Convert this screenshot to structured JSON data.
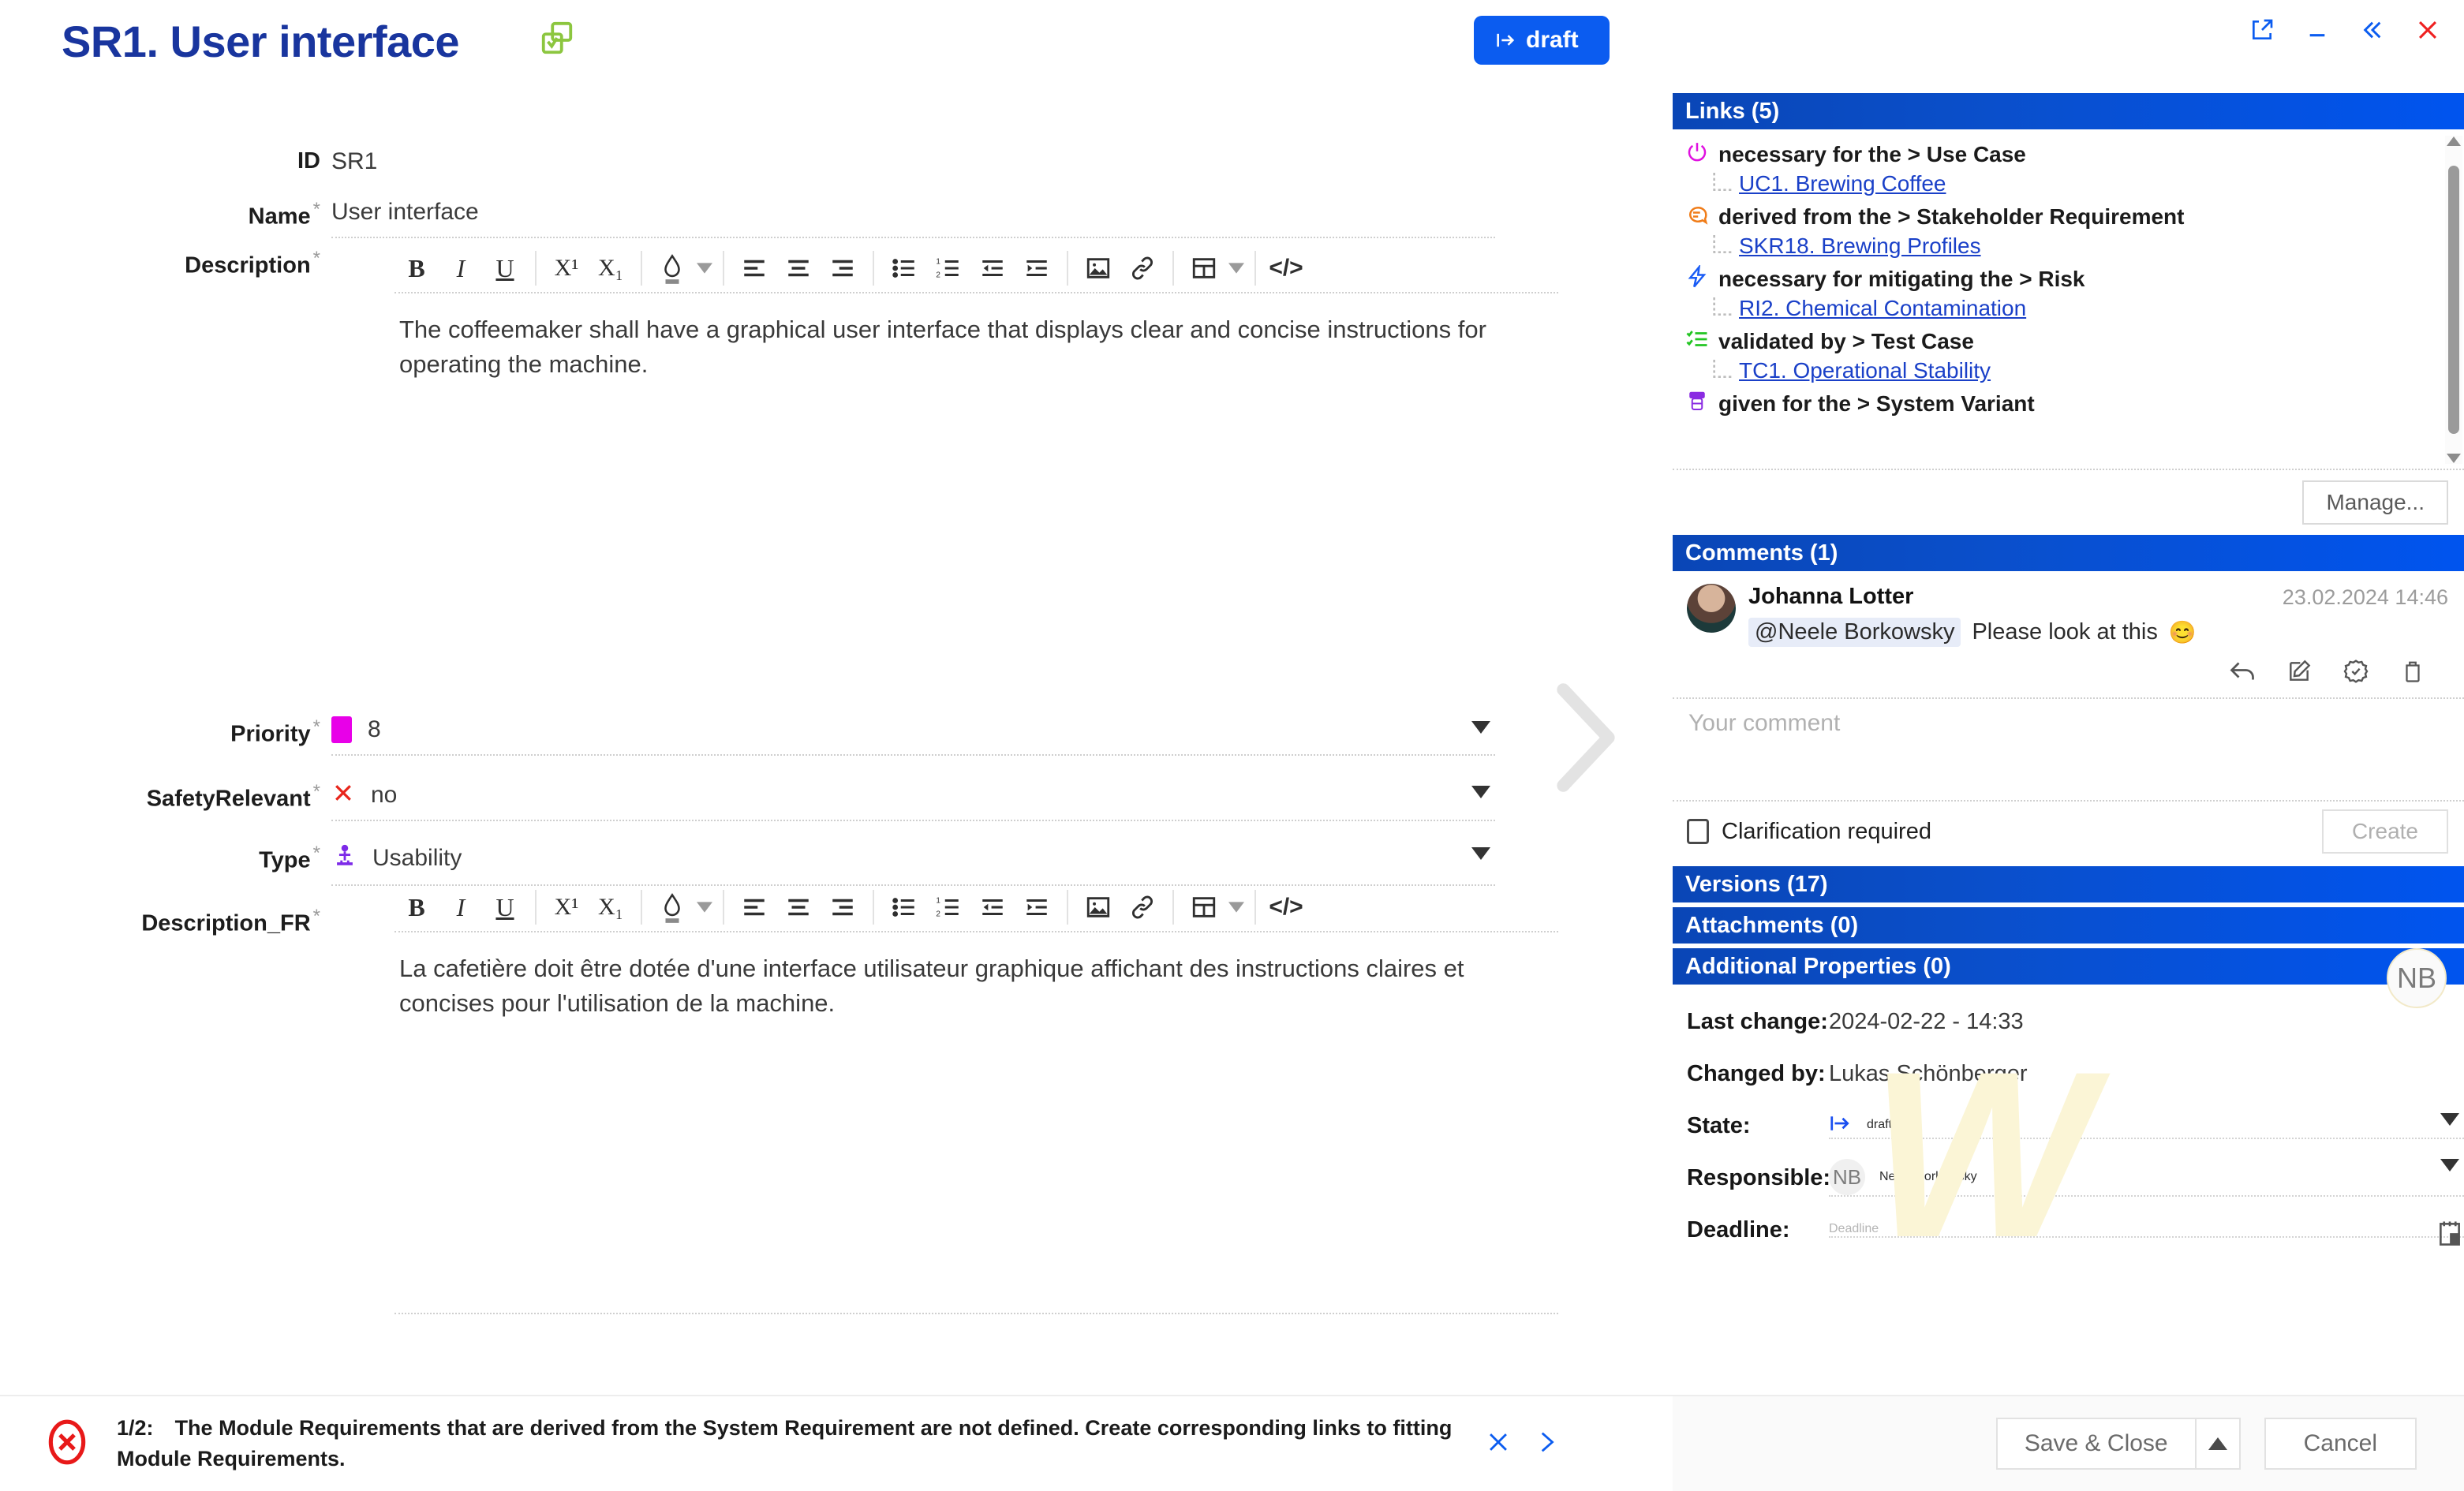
{
  "header": {
    "title": "SR1. User interface",
    "title_icon": "duplicate-document-icon",
    "state_badge": "draft",
    "window_controls": [
      "external-link-icon",
      "minimize-icon",
      "collapse-left-icon",
      "close-icon"
    ]
  },
  "form": {
    "id": {
      "label": "ID",
      "value": "SR1"
    },
    "name": {
      "label": "Name",
      "required": "*",
      "value": "User interface"
    },
    "description": {
      "label": "Description",
      "required": "*",
      "value": "The coffeemaker shall have a graphical user interface that displays clear and concise instructions for operating the machine."
    },
    "priority": {
      "label": "Priority",
      "required": "*",
      "value": "8",
      "color": "#e800e8"
    },
    "safety_relevant": {
      "label": "SafetyRelevant",
      "required": "*",
      "value": "no"
    },
    "type": {
      "label": "Type",
      "required": "*",
      "value": "Usability"
    },
    "description_fr": {
      "label": "Description_FR",
      "required": "*",
      "value": "La cafetière doit être dotée d'une interface utilisateur graphique affichant des instructions claires et concises pour l'utilisation de la machine."
    },
    "toolbar": {
      "bold": "B",
      "italic": "I",
      "underline": "U",
      "superscript": "X¹",
      "subscript": "X₁",
      "text_color": "text-color-icon",
      "color_caret": "chevron-down-icon",
      "align_left": "align-left-icon",
      "align_center": "align-center-icon",
      "align_right": "align-right-icon",
      "bullet_list": "bullet-list-icon",
      "numbered_list": "numbered-list-icon",
      "outdent": "outdent-icon",
      "indent": "indent-icon",
      "image": "image-icon",
      "link": "link-icon",
      "table": "table-icon",
      "table_caret": "chevron-down-icon",
      "source": "</>"
    }
  },
  "sidebar": {
    "links": {
      "title": "Links (5)",
      "groups": [
        {
          "icon": "power-icon",
          "icon_color": "#e011e0",
          "label": "necessary for the > Use Case",
          "children": [
            "UC1. Brewing Coffee"
          ]
        },
        {
          "icon": "speech-bubble-icon",
          "icon_color": "#f07c18",
          "label": "derived from the > Stakeholder Requirement",
          "children": [
            "SKR18. Brewing Profiles"
          ]
        },
        {
          "icon": "lightning-icon",
          "icon_color": "#1a5cf5",
          "label": "necessary for mitigating the > Risk",
          "children": [
            "RI2. Chemical Contamination"
          ]
        },
        {
          "icon": "checklist-icon",
          "icon_color": "#22c522",
          "label": "validated by > Test Case",
          "children": [
            "TC1. Operational Stability"
          ]
        },
        {
          "icon": "variant-box-icon",
          "icon_color": "#8a2be2",
          "label": "given for the > System Variant",
          "children": []
        }
      ],
      "manage_label": "Manage..."
    },
    "comments": {
      "title": "Comments (1)",
      "items": [
        {
          "author": "Johanna Lotter",
          "timestamp": "23.02.2024 14:46",
          "mention": "@Neele Borkowsky",
          "text": "Please look at this",
          "emoji": "😊",
          "actions": [
            "reply-icon",
            "edit-icon",
            "resolve-icon",
            "delete-icon"
          ]
        }
      ],
      "input_placeholder": "Your comment",
      "clarification_label": "Clarification required",
      "create_label": "Create"
    },
    "versions": {
      "title": "Versions (17)"
    },
    "attachments": {
      "title": "Attachments (0)"
    },
    "additional_properties": {
      "title": "Additional Properties (0)",
      "rows": [
        {
          "label": "Last change:",
          "value": "2024-02-22 - 14:33"
        },
        {
          "label": "Changed by:",
          "value": "Lukas Schönberger"
        },
        {
          "label": "State:",
          "value": "draft"
        },
        {
          "label": "Responsible:",
          "value": "Neele Borkowsky",
          "initials": "NB"
        },
        {
          "label": "Deadline:",
          "placeholder": "Deadline"
        }
      ],
      "avatar_initials": "NB"
    }
  },
  "notice": {
    "counter": "1/2:",
    "message": "The Module Requirements that are derived from the System Requirement are not defined. Create corresponding links to fitting Module Requirements.",
    "dismiss_icon": "close-icon",
    "next_icon": "chevron-right-icon"
  },
  "footer": {
    "save_close_label": "Save & Close",
    "save_caret": "chevron-up-icon",
    "cancel_label": "Cancel"
  },
  "watermark": "W"
}
